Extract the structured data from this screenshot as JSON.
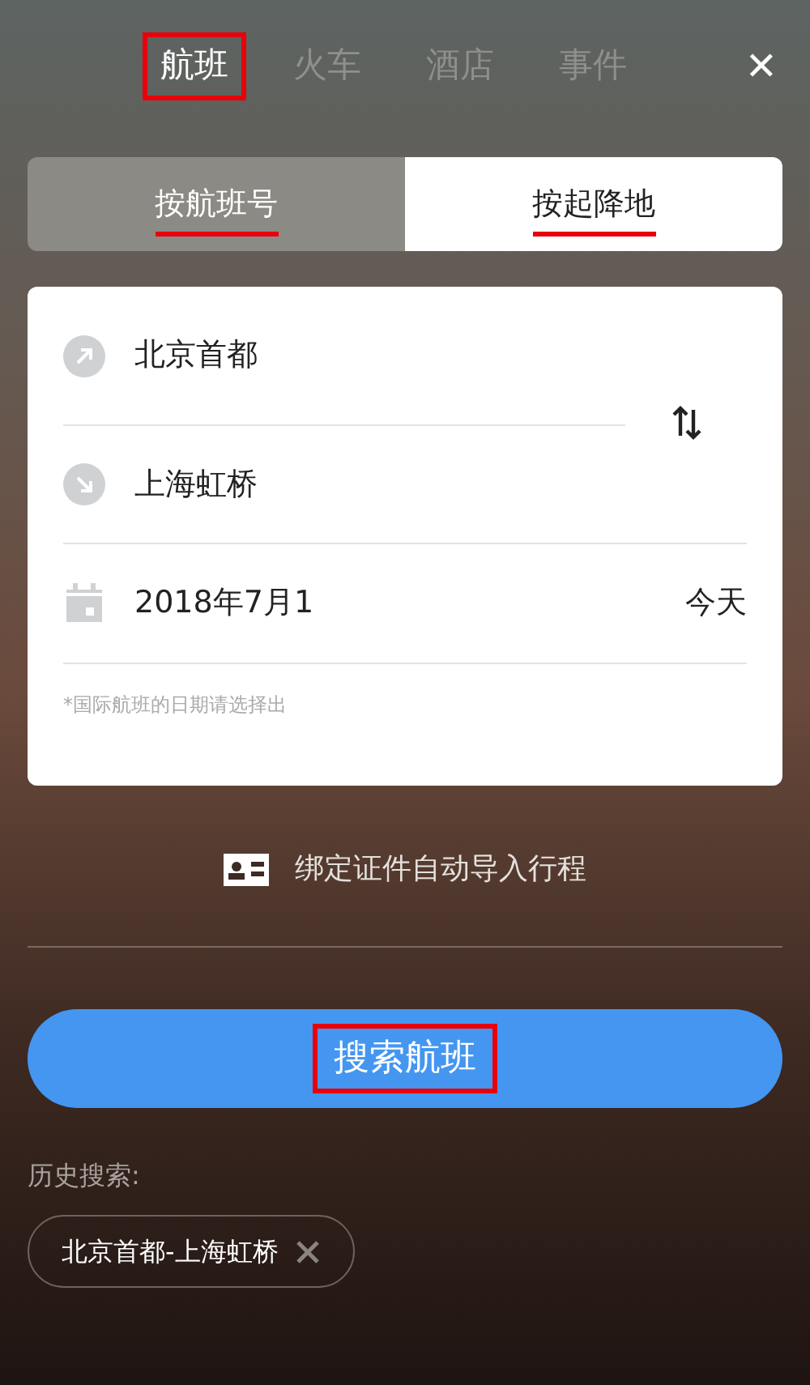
{
  "top_tabs": [
    {
      "label": "航班",
      "selected": true,
      "highlighted": true
    },
    {
      "label": "火车",
      "selected": false,
      "highlighted": false
    },
    {
      "label": "酒店",
      "selected": false,
      "highlighted": false
    },
    {
      "label": "事件",
      "selected": false,
      "highlighted": false
    }
  ],
  "close": "✕",
  "mode_tabs": [
    {
      "label": "按航班号",
      "selected": false,
      "underlined": true
    },
    {
      "label": "按起降地",
      "selected": true,
      "underlined": true
    }
  ],
  "form": {
    "from": "北京首都",
    "to": "上海虹桥",
    "date": "2018年7月1",
    "date_hint": "今天",
    "note": "*国际航班的日期请选择出"
  },
  "bind_link": "绑定证件自动导入行程",
  "search_button": {
    "label": "搜索航班",
    "highlighted": true
  },
  "history": {
    "label": "历史搜索:",
    "items": [
      {
        "label": "北京首都-上海虹桥"
      }
    ]
  }
}
